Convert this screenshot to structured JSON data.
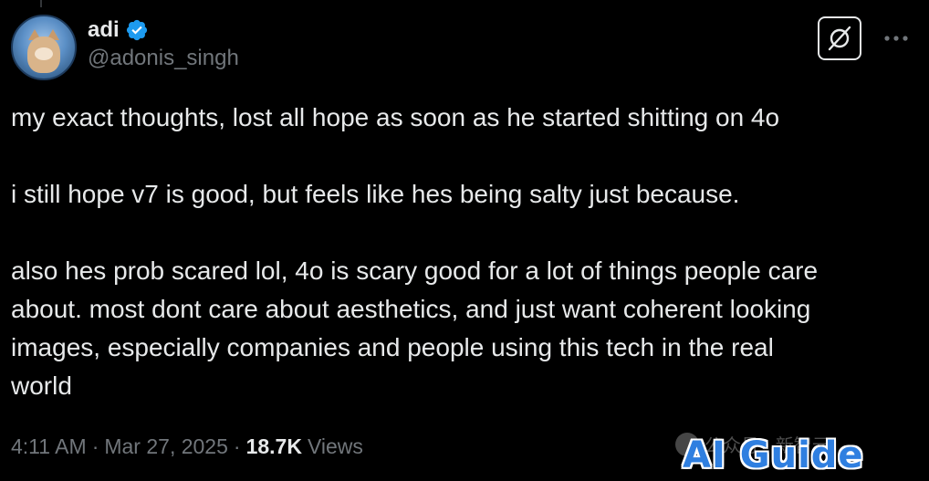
{
  "tweet": {
    "author": {
      "display_name": "adi",
      "handle": "@adonis_singh",
      "verified": true,
      "verified_color": "#1d9bf0"
    },
    "body_paragraphs": [
      [
        "my exact thoughts, lost all hope as soon as he started shitting on 4o"
      ],
      [
        "i still hope v7 is good, but feels like hes being salty just because."
      ],
      [
        "also hes prob scared lol, 4o is scary good for a lot of things people care",
        "about. most dont care about aesthetics, and just want coherent looking",
        "images, especially companies and people using this tech in the real",
        "world"
      ]
    ],
    "meta": {
      "time": "4:11 AM",
      "separator": "·",
      "date": "Mar 27, 2025",
      "views_count": "18.7K",
      "views_label": "Views"
    }
  },
  "icons": {
    "grok": "grok-icon",
    "more": "more-icon",
    "verified": "verified-badge-icon"
  },
  "watermark": {
    "small_text": "公众号 · 新智元",
    "big_text": "AI Guide"
  }
}
